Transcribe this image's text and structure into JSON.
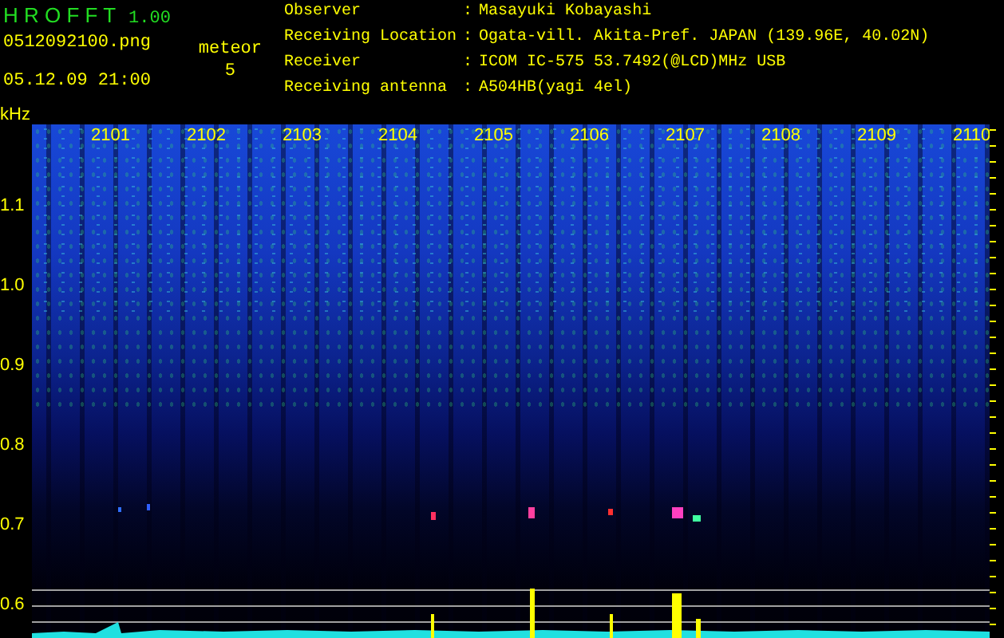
{
  "app": {
    "name": "H R O F F T",
    "version": "1.00"
  },
  "file": "0512092100.png",
  "datetime": "05.12.09 21:00",
  "meteor": {
    "label": "meteor",
    "count": "5"
  },
  "info": [
    {
      "label": "Observer",
      "separator": ":",
      "value": "Masayuki Kobayashi"
    },
    {
      "label": "Receiving Location",
      "separator": ":",
      "value": "Ogata-vill. Akita-Pref. JAPAN (139.96E, 40.02N)"
    },
    {
      "label": "Receiver",
      "separator": ":",
      "value": "ICOM IC-575 53.7492(@LCD)MHz USB"
    },
    {
      "label": "Receiving antenna",
      "separator": ":",
      "value": "A504HB(yagi 4el)"
    }
  ],
  "spectrogram": {
    "unit": "kHz",
    "time_labels": [
      "2101",
      "2102",
      "2103",
      "2104",
      "2105",
      "2106",
      "2107",
      "2108",
      "2109",
      "2110"
    ],
    "freq_labels": [
      "1.1",
      "1.0",
      "0.9",
      "0.8",
      "0.7",
      "0.6"
    ]
  }
}
